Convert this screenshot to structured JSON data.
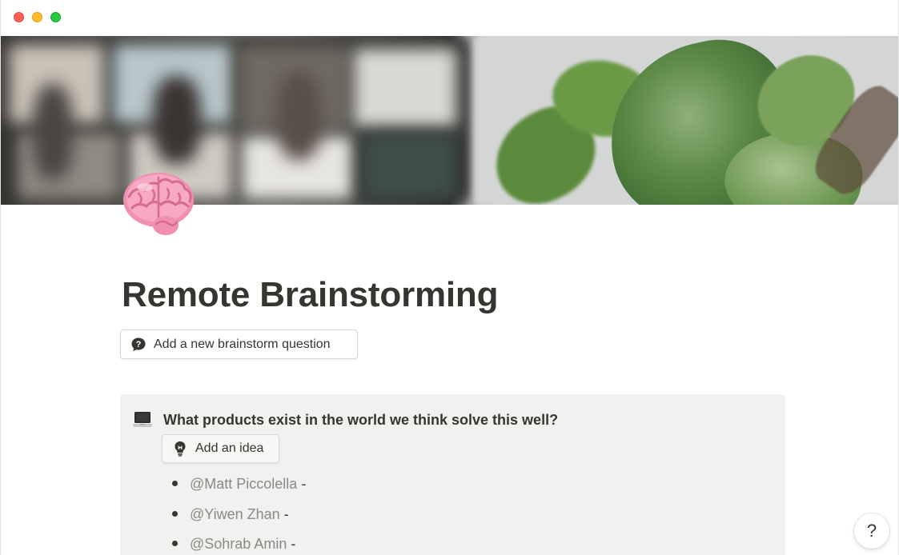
{
  "window": {
    "controls": [
      "close",
      "minimize",
      "zoom"
    ]
  },
  "cover": {
    "icon": "cover-photo"
  },
  "page": {
    "icon": "brain-emoji",
    "title": "Remote Brainstorming"
  },
  "buttons": {
    "add_question": {
      "label": "Add a new brainstorm question",
      "icon": "question-bubble-icon"
    }
  },
  "callout": {
    "icon": "laptop-emoji",
    "heading": "What products exist in the world we think solve this well?",
    "add_idea": {
      "label": "Add an idea",
      "icon": "lightbulb-icon"
    },
    "items": [
      {
        "mention": "@Matt Piccolella",
        "text": "-"
      },
      {
        "mention": "@Yiwen Zhan",
        "text": "-"
      },
      {
        "mention": "@Sohrab Amin",
        "text": "-"
      }
    ]
  },
  "help": {
    "label": "?"
  },
  "colors": {
    "text": "#37352f",
    "mention": "#8a8985",
    "callout_bg": "#f1f1ef",
    "close": "#fe5f57",
    "minimize": "#febc2e",
    "zoom": "#28c840"
  }
}
